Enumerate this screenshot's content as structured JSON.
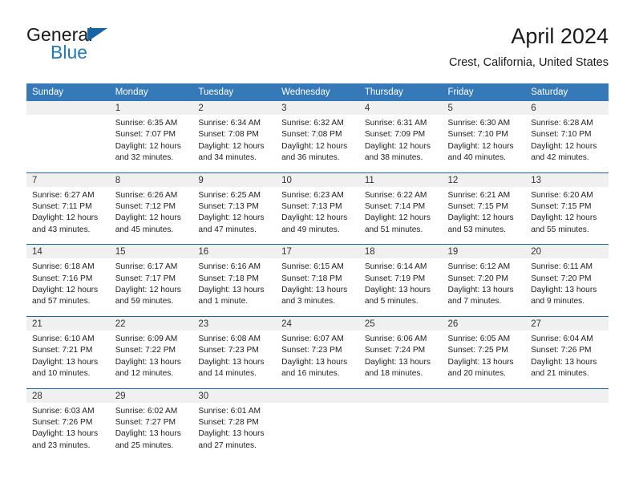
{
  "brand": {
    "name_part1": "General",
    "name_part2": "Blue",
    "triangle_icon": "triangle-icon",
    "accent_color": "#1f7ac0",
    "header_color": "#3579b8",
    "rule_color": "#1565a8"
  },
  "header": {
    "title": "April 2024",
    "subtitle": "Crest, California, United States"
  },
  "calendar": {
    "weekday_headers": [
      "Sunday",
      "Monday",
      "Tuesday",
      "Wednesday",
      "Thursday",
      "Friday",
      "Saturday"
    ],
    "weeks": [
      [
        {
          "day": "",
          "sunrise": "",
          "sunset": "",
          "daylight": "",
          "empty": true
        },
        {
          "day": "1",
          "sunrise": "Sunrise: 6:35 AM",
          "sunset": "Sunset: 7:07 PM",
          "daylight": "Daylight: 12 hours and 32 minutes."
        },
        {
          "day": "2",
          "sunrise": "Sunrise: 6:34 AM",
          "sunset": "Sunset: 7:08 PM",
          "daylight": "Daylight: 12 hours and 34 minutes."
        },
        {
          "day": "3",
          "sunrise": "Sunrise: 6:32 AM",
          "sunset": "Sunset: 7:08 PM",
          "daylight": "Daylight: 12 hours and 36 minutes."
        },
        {
          "day": "4",
          "sunrise": "Sunrise: 6:31 AM",
          "sunset": "Sunset: 7:09 PM",
          "daylight": "Daylight: 12 hours and 38 minutes."
        },
        {
          "day": "5",
          "sunrise": "Sunrise: 6:30 AM",
          "sunset": "Sunset: 7:10 PM",
          "daylight": "Daylight: 12 hours and 40 minutes."
        },
        {
          "day": "6",
          "sunrise": "Sunrise: 6:28 AM",
          "sunset": "Sunset: 7:10 PM",
          "daylight": "Daylight: 12 hours and 42 minutes."
        }
      ],
      [
        {
          "day": "7",
          "sunrise": "Sunrise: 6:27 AM",
          "sunset": "Sunset: 7:11 PM",
          "daylight": "Daylight: 12 hours and 43 minutes."
        },
        {
          "day": "8",
          "sunrise": "Sunrise: 6:26 AM",
          "sunset": "Sunset: 7:12 PM",
          "daylight": "Daylight: 12 hours and 45 minutes."
        },
        {
          "day": "9",
          "sunrise": "Sunrise: 6:25 AM",
          "sunset": "Sunset: 7:13 PM",
          "daylight": "Daylight: 12 hours and 47 minutes."
        },
        {
          "day": "10",
          "sunrise": "Sunrise: 6:23 AM",
          "sunset": "Sunset: 7:13 PM",
          "daylight": "Daylight: 12 hours and 49 minutes."
        },
        {
          "day": "11",
          "sunrise": "Sunrise: 6:22 AM",
          "sunset": "Sunset: 7:14 PM",
          "daylight": "Daylight: 12 hours and 51 minutes."
        },
        {
          "day": "12",
          "sunrise": "Sunrise: 6:21 AM",
          "sunset": "Sunset: 7:15 PM",
          "daylight": "Daylight: 12 hours and 53 minutes."
        },
        {
          "day": "13",
          "sunrise": "Sunrise: 6:20 AM",
          "sunset": "Sunset: 7:15 PM",
          "daylight": "Daylight: 12 hours and 55 minutes."
        }
      ],
      [
        {
          "day": "14",
          "sunrise": "Sunrise: 6:18 AM",
          "sunset": "Sunset: 7:16 PM",
          "daylight": "Daylight: 12 hours and 57 minutes."
        },
        {
          "day": "15",
          "sunrise": "Sunrise: 6:17 AM",
          "sunset": "Sunset: 7:17 PM",
          "daylight": "Daylight: 12 hours and 59 minutes."
        },
        {
          "day": "16",
          "sunrise": "Sunrise: 6:16 AM",
          "sunset": "Sunset: 7:18 PM",
          "daylight": "Daylight: 13 hours and 1 minute."
        },
        {
          "day": "17",
          "sunrise": "Sunrise: 6:15 AM",
          "sunset": "Sunset: 7:18 PM",
          "daylight": "Daylight: 13 hours and 3 minutes."
        },
        {
          "day": "18",
          "sunrise": "Sunrise: 6:14 AM",
          "sunset": "Sunset: 7:19 PM",
          "daylight": "Daylight: 13 hours and 5 minutes."
        },
        {
          "day": "19",
          "sunrise": "Sunrise: 6:12 AM",
          "sunset": "Sunset: 7:20 PM",
          "daylight": "Daylight: 13 hours and 7 minutes."
        },
        {
          "day": "20",
          "sunrise": "Sunrise: 6:11 AM",
          "sunset": "Sunset: 7:20 PM",
          "daylight": "Daylight: 13 hours and 9 minutes."
        }
      ],
      [
        {
          "day": "21",
          "sunrise": "Sunrise: 6:10 AM",
          "sunset": "Sunset: 7:21 PM",
          "daylight": "Daylight: 13 hours and 10 minutes."
        },
        {
          "day": "22",
          "sunrise": "Sunrise: 6:09 AM",
          "sunset": "Sunset: 7:22 PM",
          "daylight": "Daylight: 13 hours and 12 minutes."
        },
        {
          "day": "23",
          "sunrise": "Sunrise: 6:08 AM",
          "sunset": "Sunset: 7:23 PM",
          "daylight": "Daylight: 13 hours and 14 minutes."
        },
        {
          "day": "24",
          "sunrise": "Sunrise: 6:07 AM",
          "sunset": "Sunset: 7:23 PM",
          "daylight": "Daylight: 13 hours and 16 minutes."
        },
        {
          "day": "25",
          "sunrise": "Sunrise: 6:06 AM",
          "sunset": "Sunset: 7:24 PM",
          "daylight": "Daylight: 13 hours and 18 minutes."
        },
        {
          "day": "26",
          "sunrise": "Sunrise: 6:05 AM",
          "sunset": "Sunset: 7:25 PM",
          "daylight": "Daylight: 13 hours and 20 minutes."
        },
        {
          "day": "27",
          "sunrise": "Sunrise: 6:04 AM",
          "sunset": "Sunset: 7:26 PM",
          "daylight": "Daylight: 13 hours and 21 minutes."
        }
      ],
      [
        {
          "day": "28",
          "sunrise": "Sunrise: 6:03 AM",
          "sunset": "Sunset: 7:26 PM",
          "daylight": "Daylight: 13 hours and 23 minutes."
        },
        {
          "day": "29",
          "sunrise": "Sunrise: 6:02 AM",
          "sunset": "Sunset: 7:27 PM",
          "daylight": "Daylight: 13 hours and 25 minutes."
        },
        {
          "day": "30",
          "sunrise": "Sunrise: 6:01 AM",
          "sunset": "Sunset: 7:28 PM",
          "daylight": "Daylight: 13 hours and 27 minutes."
        },
        {
          "day": "",
          "sunrise": "",
          "sunset": "",
          "daylight": "",
          "empty": true
        },
        {
          "day": "",
          "sunrise": "",
          "sunset": "",
          "daylight": "",
          "empty": true
        },
        {
          "day": "",
          "sunrise": "",
          "sunset": "",
          "daylight": "",
          "empty": true
        },
        {
          "day": "",
          "sunrise": "",
          "sunset": "",
          "daylight": "",
          "empty": true
        }
      ]
    ]
  }
}
